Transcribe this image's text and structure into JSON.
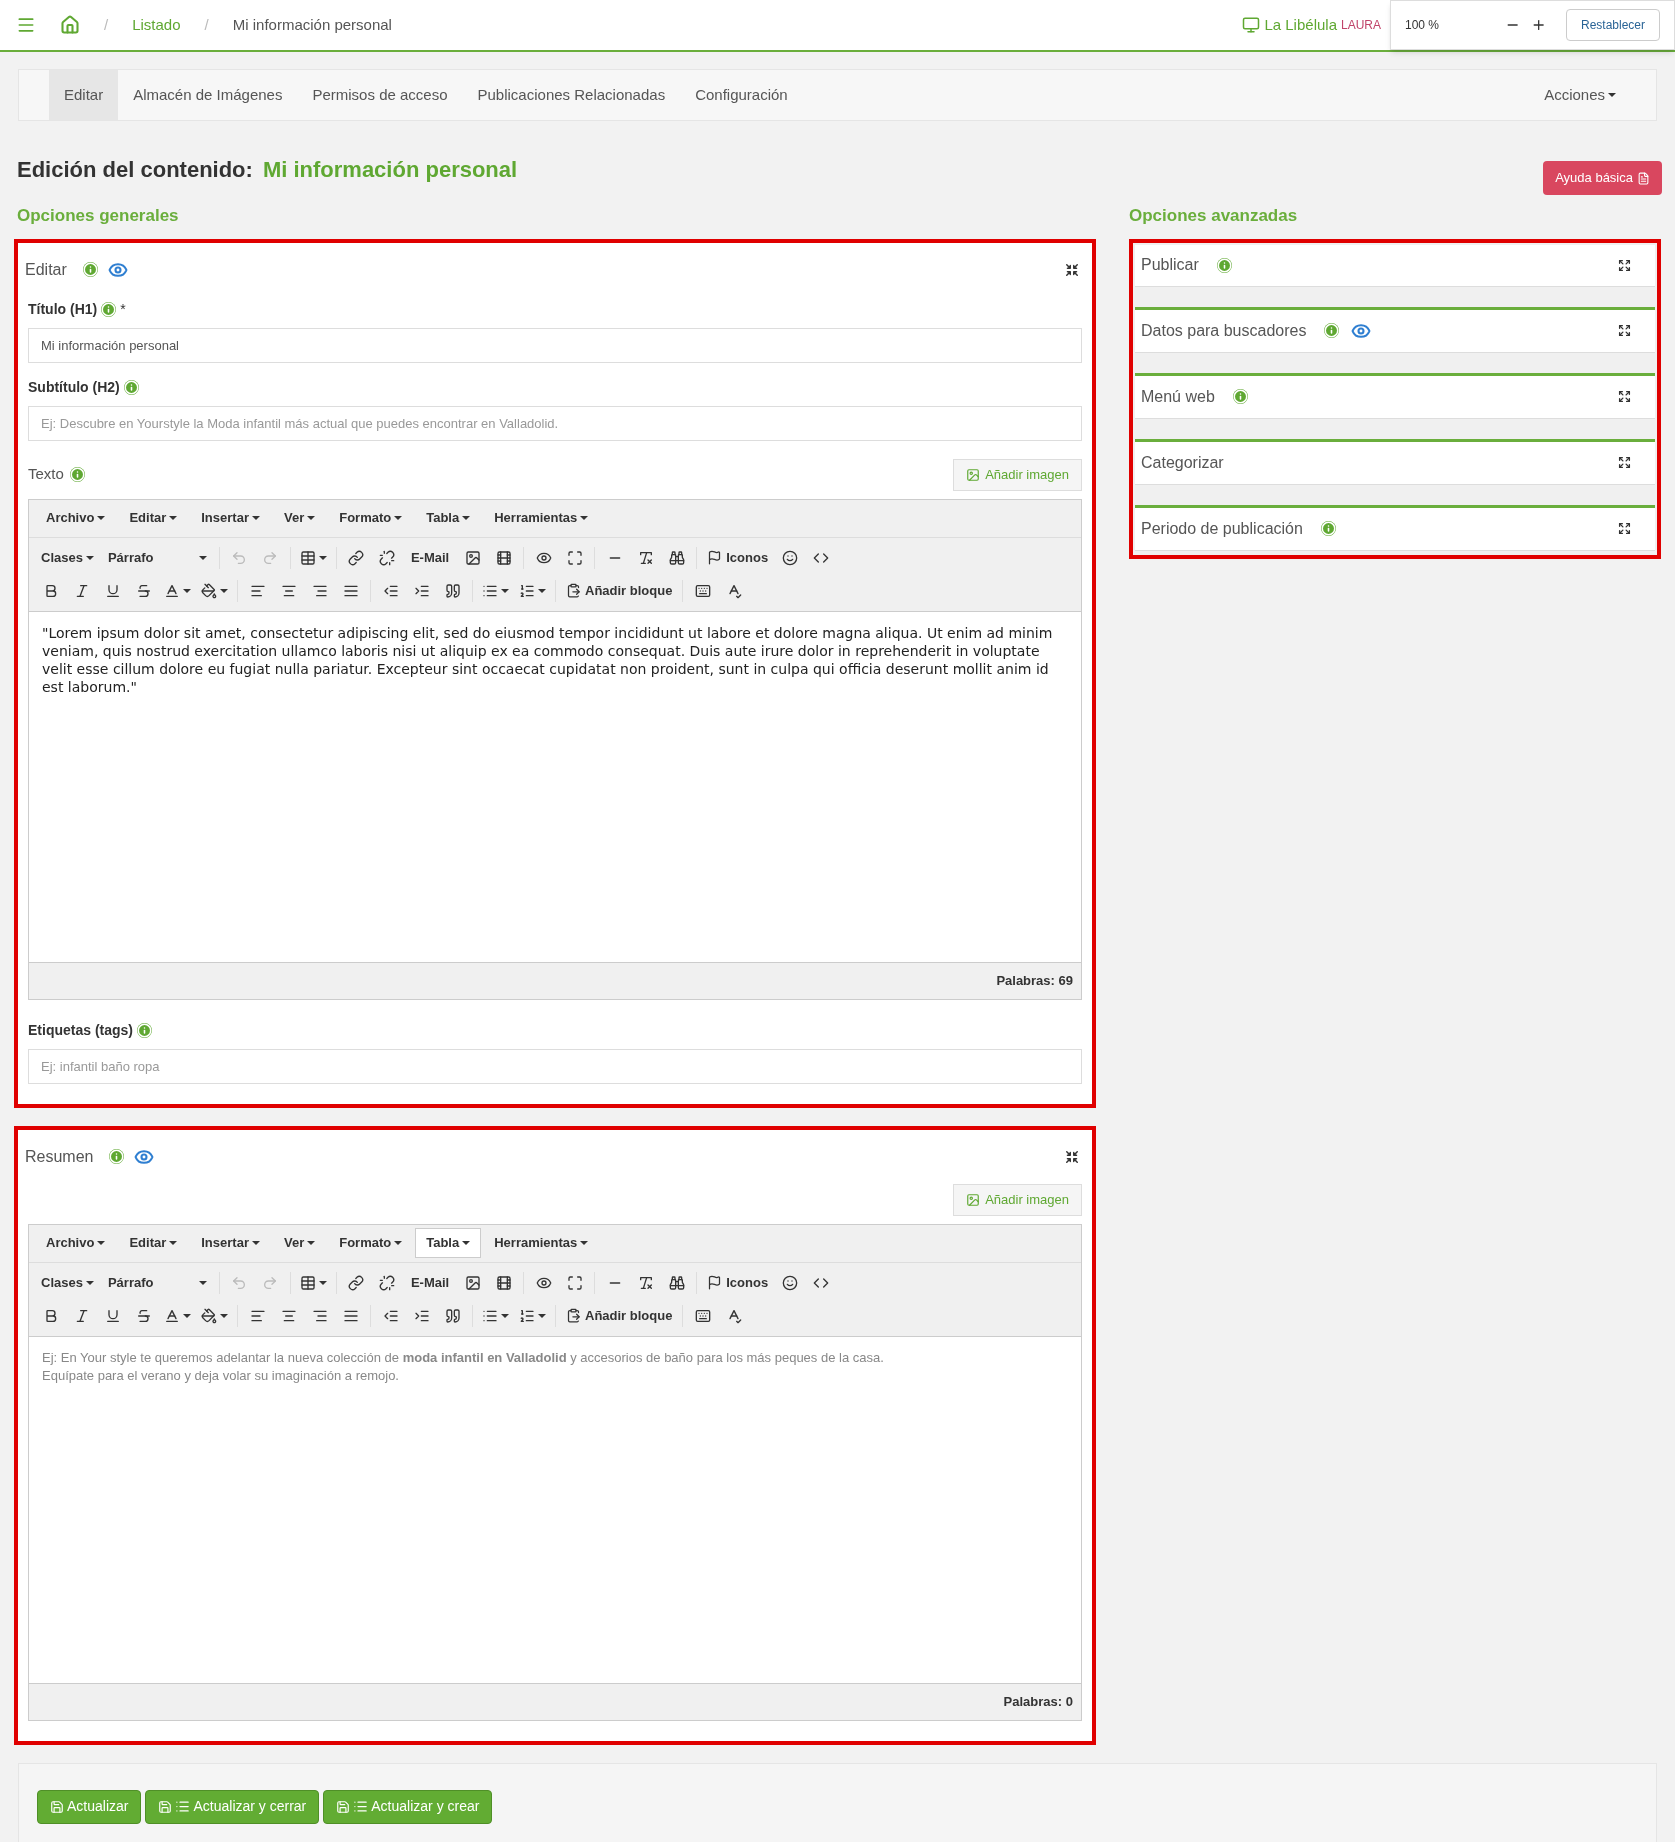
{
  "topbar": {
    "breadcrumb": [
      {
        "separator": "/",
        "label": "Listado"
      },
      {
        "separator": "/",
        "label": "Mi información personal"
      }
    ],
    "site": "La Libélula",
    "user": "LAURA",
    "zoom": {
      "value": "100 %",
      "reset": "Restablecer"
    }
  },
  "tabs": [
    {
      "label": "Editar",
      "selected": true
    },
    {
      "label": "Almacén de Imágenes",
      "selected": false
    },
    {
      "label": "Permisos de acceso",
      "selected": false
    },
    {
      "label": "Publicaciones Relacionadas",
      "selected": false
    },
    {
      "label": "Configuración",
      "selected": false
    }
  ],
  "actions": "Acciones",
  "heading": {
    "label": "Edición del contenido:",
    "title": "Mi información personal"
  },
  "help_button": "Ayuda básica",
  "general": {
    "title": "Opciones generales",
    "panels": [
      {
        "title": "Editar",
        "info": true,
        "preview": true,
        "fields": [
          {
            "label": "Título (H1)",
            "mark": "*",
            "value": "Mi información personal"
          },
          {
            "label": "Subtítulo (H2)",
            "placeholder": "Ej: Descubre en Yourstyle la Moda infantil más actual que puedes encontrar en Valladolid."
          }
        ],
        "text_label": "Texto",
        "add_image": "Añadir imagen",
        "editor": {
          "menus": [
            {
              "label": "Archivo",
              "selected": false
            },
            {
              "label": "Editar",
              "selected": false
            },
            {
              "label": "Insertar",
              "selected": false
            },
            {
              "label": "Ver",
              "selected": false
            },
            {
              "label": "Formato",
              "selected": false
            },
            {
              "label": "Tabla",
              "selected": false
            },
            {
              "label": "Herramientas",
              "selected": false
            }
          ],
          "styles": "Clases",
          "block_format": "Párrafo",
          "email": "E-Mail",
          "icons": "Iconos",
          "add_block": "Añadir bloque",
          "undo": {
            "disabled": true
          },
          "redo": {
            "disabled": true
          },
          "content": "\"Lorem ipsum dolor sit amet, consectetur adipiscing elit, sed do eiusmod tempor incididunt ut labore et dolore magna aliqua. Ut enim ad minim veniam, quis nostrud exercitation ullamco laboris nisi ut aliquip ex ea commodo consequat. Duis aute irure dolor in reprehenderit in voluptate velit esse cillum dolore eu fugiat nulla pariatur. Excepteur sint occaecat cupidatat non proident, sunt in culpa qui officia deserunt mollit anim id est laborum.\"",
          "word_count": "Palabras: 69"
        },
        "tags": {
          "label": "Etiquetas (tags)",
          "placeholder": "Ej: infantil baño ropa"
        }
      },
      {
        "title": "Resumen",
        "info": true,
        "preview": true,
        "add_image": "Añadir imagen",
        "editor": {
          "menus": [
            {
              "label": "Archivo",
              "selected": false
            },
            {
              "label": "Editar",
              "selected": false
            },
            {
              "label": "Insertar",
              "selected": false
            },
            {
              "label": "Ver",
              "selected": false
            },
            {
              "label": "Formato",
              "selected": false
            },
            {
              "label": "Tabla",
              "selected": true
            },
            {
              "label": "Herramientas",
              "selected": false
            }
          ],
          "styles": "Clases",
          "block_format": "Párrafo",
          "email": "E-Mail",
          "icons": "Iconos",
          "add_block": "Añadir bloque",
          "undo": {
            "disabled": true
          },
          "redo": {
            "disabled": true
          },
          "placeholder_lines": [
            "Ej: En Your style te queremos adelantar la nueva colección de **moda infantil en Valladolid** y accesorios de baño para los más peques de la casa.",
            "Equípate para el verano y deja volar su imaginación a remojo."
          ],
          "word_count": "Palabras: 0"
        }
      }
    ]
  },
  "advanced": {
    "title": "Opciones avanzadas",
    "sections": [
      {
        "label": "Publicar",
        "info": true,
        "preview": false
      },
      {
        "label": "Datos para buscadores",
        "info": true,
        "preview": true
      },
      {
        "label": "Menú web",
        "info": true,
        "preview": false
      },
      {
        "label": "Categorizar",
        "info": false,
        "preview": false
      },
      {
        "label": "Periodo de publicación",
        "info": true,
        "preview": false
      }
    ]
  },
  "footer_buttons": [
    {
      "label": "Actualizar",
      "kind": "save"
    },
    {
      "label": "Actualizar y cerrar",
      "kind": "save_list"
    },
    {
      "label": "Actualizar y crear",
      "kind": "save_list"
    }
  ]
}
